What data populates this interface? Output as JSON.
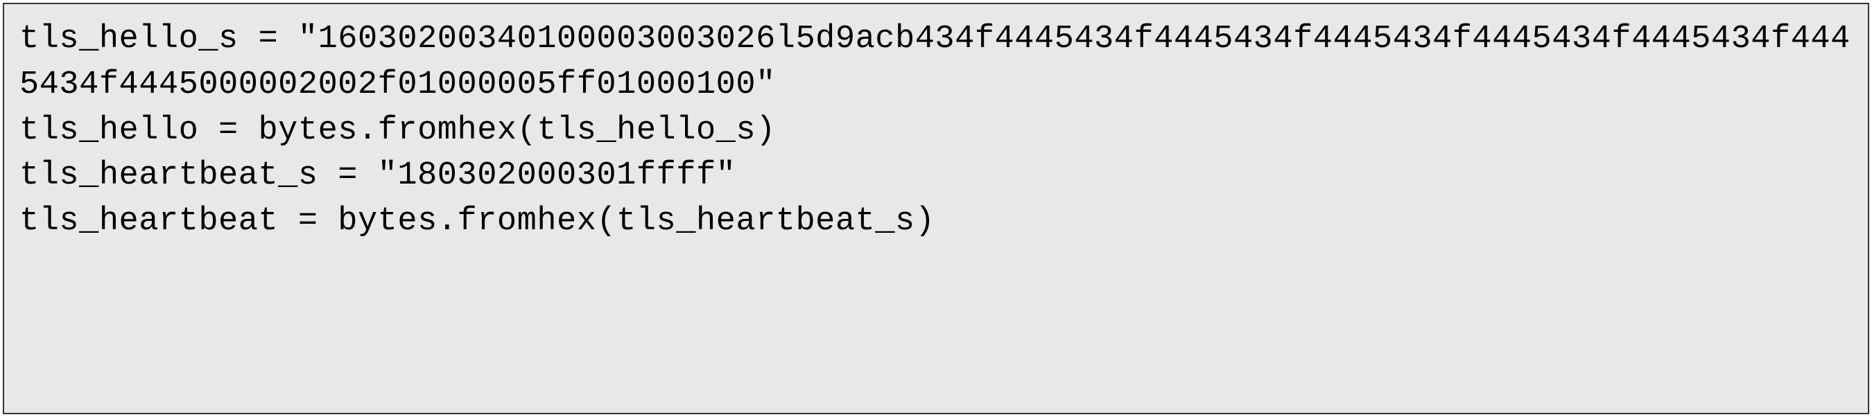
{
  "code": {
    "line1": "tls_hello_s = \"16030200340100003003026l5d9acb434f4445434f4445434f4445434f4445434f4445434f4445434f4445000002002f01000005ff01000100\"",
    "line2": "",
    "line3": "tls_hello = bytes.fromhex(tls_hello_s)",
    "line4": "",
    "line5": "",
    "line6": "",
    "line7": "tls_heartbeat_s = \"180302000301ffff\"",
    "line8": "",
    "line9": "tls_heartbeat = bytes.fromhex(tls_heartbeat_s)"
  }
}
